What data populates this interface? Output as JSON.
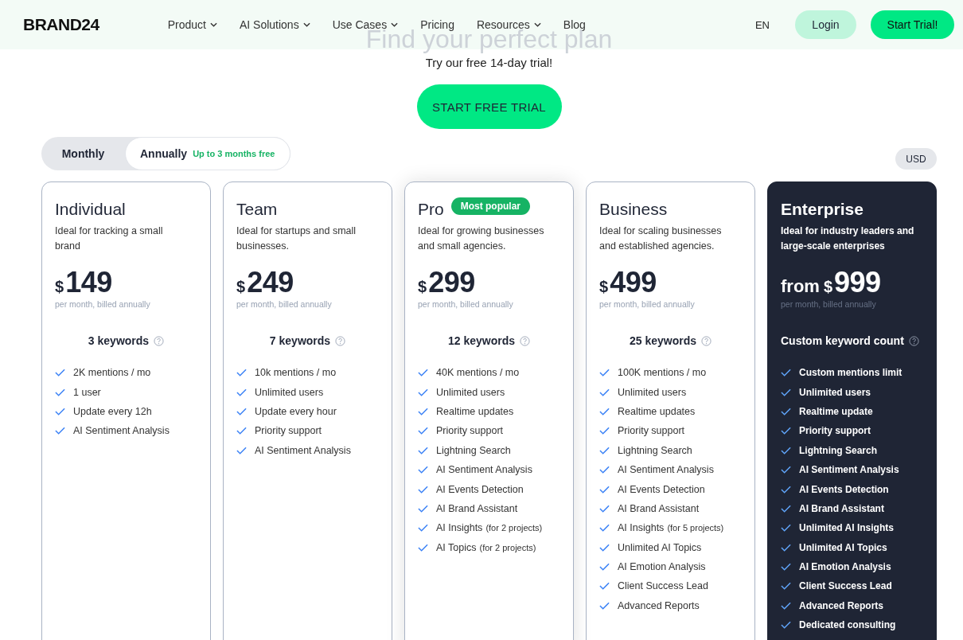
{
  "header": {
    "logo": "BRAND24",
    "nav": [
      {
        "label": "Product",
        "dropdown": true
      },
      {
        "label": "AI Solutions",
        "dropdown": true
      },
      {
        "label": "Use Cases",
        "dropdown": true
      },
      {
        "label": "Pricing",
        "dropdown": false
      },
      {
        "label": "Resources",
        "dropdown": true
      },
      {
        "label": "Blog",
        "dropdown": false
      }
    ],
    "language": "EN",
    "login": "Login",
    "cta": "Start Trial!"
  },
  "hero": {
    "title": "Find your perfect plan",
    "subtitle": "Try our free 14-day trial!",
    "button": "START FREE TRIAL"
  },
  "billing_toggle": [
    {
      "label": "Monthly",
      "selected": false
    },
    {
      "label": "Annually",
      "note": "Up to 3 months free",
      "selected": true
    }
  ],
  "currency": "USD",
  "plans": [
    {
      "name": "Individual",
      "kind": "light",
      "featured": false,
      "description": "Ideal for tracking a small brand",
      "currency": "$",
      "price": "149",
      "billing": "per month, billed annually",
      "keywords": "3 keywords",
      "features": [
        {
          "text": "2K mentions / mo"
        },
        {
          "text": "1 user"
        },
        {
          "text": "Update every 12h"
        },
        {
          "text": "AI Sentiment Analysis"
        }
      ]
    },
    {
      "name": "Team",
      "kind": "light",
      "featured": false,
      "description": "Ideal for startups and small businesses.",
      "currency": "$",
      "price": "249",
      "billing": "per month, billed annually",
      "keywords": "7 keywords",
      "features": [
        {
          "text": "10k mentions / mo"
        },
        {
          "text": "Unlimited users"
        },
        {
          "text": "Update every hour"
        },
        {
          "text": "Priority support"
        },
        {
          "text": "AI Sentiment Analysis"
        }
      ]
    },
    {
      "name": "Pro",
      "badge": "Most popular",
      "kind": "light",
      "featured": true,
      "description": "Ideal for growing businesses and small agencies.",
      "currency": "$",
      "price": "299",
      "billing": "per month, billed annually",
      "keywords": "12 keywords",
      "features": [
        {
          "text": "40K mentions / mo"
        },
        {
          "text": "Unlimited users"
        },
        {
          "text": "Realtime updates"
        },
        {
          "text": "Priority support"
        },
        {
          "text": "Lightning Search"
        },
        {
          "text": "AI Sentiment Analysis"
        },
        {
          "text": "AI Events Detection"
        },
        {
          "text": "AI Brand Assistant"
        },
        {
          "text": "AI Insights",
          "note": "(for 2 projects)"
        },
        {
          "text": "AI Topics",
          "note": "(for 2 projects)"
        }
      ]
    },
    {
      "name": "Business",
      "kind": "light",
      "featured": false,
      "description": "Ideal for scaling businesses and established agencies.",
      "currency": "$",
      "price": "499",
      "billing": "per month, billed annually",
      "keywords": "25 keywords",
      "features": [
        {
          "text": "100K mentions / mo"
        },
        {
          "text": "Unlimited users"
        },
        {
          "text": "Realtime updates"
        },
        {
          "text": "Priority support"
        },
        {
          "text": "Lightning Search"
        },
        {
          "text": "AI Sentiment Analysis"
        },
        {
          "text": "AI Events Detection"
        },
        {
          "text": "AI Brand Assistant"
        },
        {
          "text": "AI Insights",
          "note": "(for 5 projects)"
        },
        {
          "text": "Unlimited AI Topics"
        },
        {
          "text": "AI Emotion Analysis"
        },
        {
          "text": "Client Success Lead"
        },
        {
          "text": "Advanced Reports"
        }
      ]
    },
    {
      "name": "Enterprise",
      "kind": "dark",
      "featured": false,
      "description": "Ideal for industry leaders and large-scale enterprises",
      "prefix": "from",
      "currency": "$",
      "price": "999",
      "billing": "per month, billed annually",
      "keywords": "Custom keyword count",
      "features": [
        {
          "text": "Custom mentions limit"
        },
        {
          "text": "Unlimited users"
        },
        {
          "text": "Realtime update"
        },
        {
          "text": "Priority support"
        },
        {
          "text": "Lightning Search"
        },
        {
          "text": "AI Sentiment Analysis"
        },
        {
          "text": "AI Events Detection"
        },
        {
          "text": "AI Brand Assistant"
        },
        {
          "text": "Unlimited AI Insights"
        },
        {
          "text": "Unlimited AI Topics"
        },
        {
          "text": "AI Emotion Analysis"
        },
        {
          "text": "Client Success Lead"
        },
        {
          "text": "Advanced Reports"
        },
        {
          "text": "Dedicated consulting"
        }
      ]
    }
  ]
}
